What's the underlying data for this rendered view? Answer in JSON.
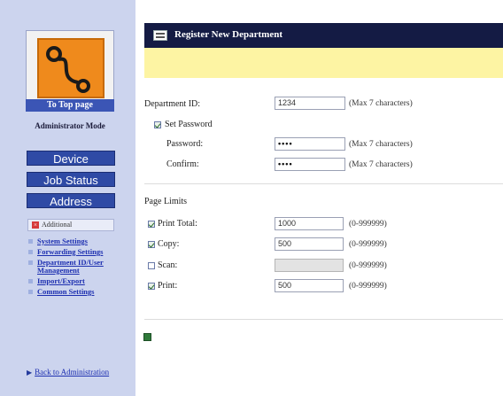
{
  "sidebar": {
    "to_top_label": "To Top page",
    "mode_label": "Administrator Mode",
    "nav": [
      "Device",
      "Job Status",
      "Address"
    ],
    "additional_label": "Additional",
    "menu": [
      "System Settings",
      "Forwarding Settings",
      "Department ID/User Management",
      "Import/Export",
      "Common Settings"
    ],
    "back_label": "Back to Administration"
  },
  "main": {
    "title": "Register New Department",
    "department_id_label": "Department ID:",
    "department_id_value": "1234",
    "department_id_hint": "(Max 7 characters)",
    "set_password_label": "Set Password",
    "password_label": "Password:",
    "password_value": "••••",
    "password_hint": "(Max 7 characters)",
    "confirm_label": "Confirm:",
    "confirm_value": "••••",
    "confirm_hint": "(Max 7 characters)",
    "page_limits_label": "Page Limits",
    "limits": [
      {
        "label": "Print Total:",
        "value": "1000",
        "hint": "(0-999999)",
        "checked": true,
        "disabled": false
      },
      {
        "label": "Copy:",
        "value": "500",
        "hint": "(0-999999)",
        "checked": true,
        "disabled": false
      },
      {
        "label": "Scan:",
        "value": "",
        "hint": "(0-999999)",
        "checked": false,
        "disabled": true
      },
      {
        "label": "Print:",
        "value": "500",
        "hint": "(0-999999)",
        "checked": true,
        "disabled": false
      }
    ]
  },
  "colors": {
    "sidebar_bg": "#ccd4ee",
    "nav_button": "#2f4aa5",
    "title_bar": "#141b44",
    "notice_bar": "#fdf4a3",
    "logo_orange": "#ef8a1c"
  },
  "icons": [
    "connector-icon",
    "form-icon",
    "close-icon",
    "arrow-right-icon",
    "checkbox-icon",
    "save-icon"
  ]
}
